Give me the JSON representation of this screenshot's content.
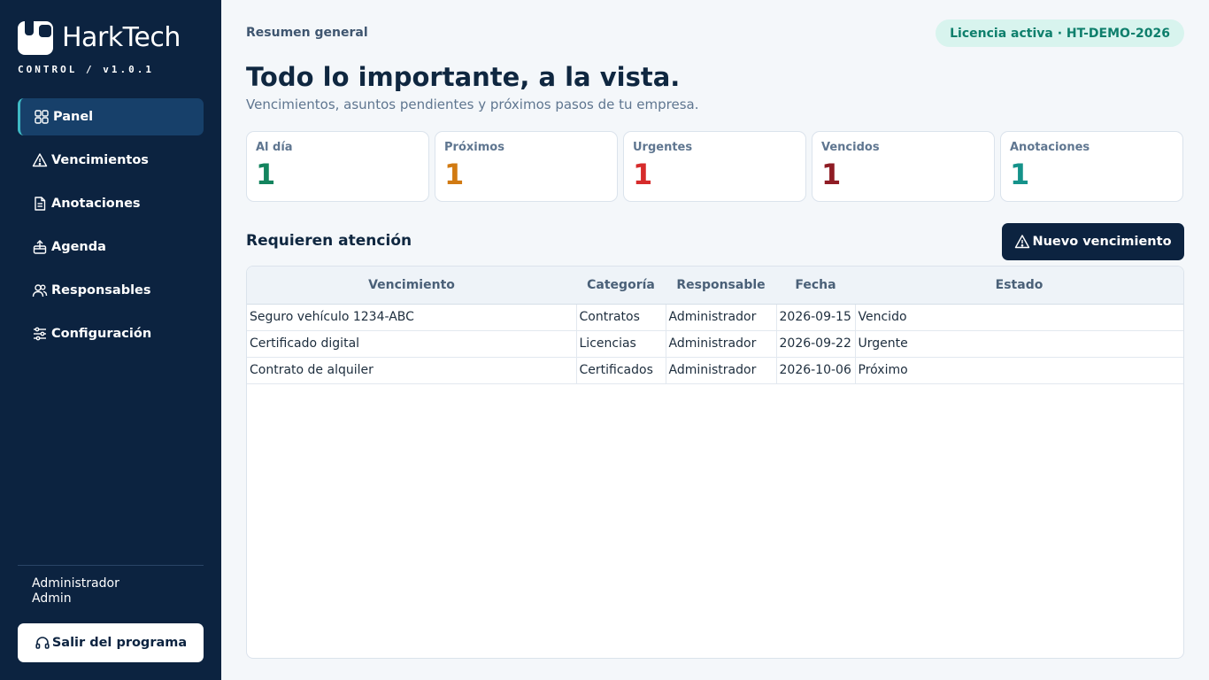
{
  "brand": {
    "name": "HarkTech",
    "subtitle": "CONTROL / v1.0.1"
  },
  "nav": [
    {
      "label": "Panel",
      "icon": "grid-icon",
      "active": true
    },
    {
      "label": "Vencimientos",
      "icon": "warning-icon"
    },
    {
      "label": "Anotaciones",
      "icon": "document-icon"
    },
    {
      "label": "Agenda",
      "icon": "upload-icon"
    },
    {
      "label": "Responsables",
      "icon": "users-icon"
    },
    {
      "label": "Configuración",
      "icon": "sliders-icon"
    }
  ],
  "user": {
    "name": "Administrador",
    "role": "Admin"
  },
  "exit_label": "Salir del programa",
  "header": {
    "breadcrumb": "Resumen general",
    "license": "Licencia activa · HT-DEMO-2026",
    "title": "Todo lo importante, a la vista.",
    "subtitle": "Vencimientos, asuntos pendientes y próximos pasos de tu empresa."
  },
  "stats": [
    {
      "label": "Al día",
      "value": "1",
      "color": "#13845e"
    },
    {
      "label": "Próximos",
      "value": "1",
      "color": "#d17a12"
    },
    {
      "label": "Urgentes",
      "value": "1",
      "color": "#d62b2b"
    },
    {
      "label": "Vencidos",
      "value": "1",
      "color": "#8f1c24"
    },
    {
      "label": "Anotaciones",
      "value": "1",
      "color": "#15928a"
    }
  ],
  "section": {
    "title": "Requieren atención",
    "new_button": "Nuevo vencimiento"
  },
  "table": {
    "columns": [
      "Vencimiento",
      "Categoría",
      "Responsable",
      "Fecha",
      "Estado"
    ],
    "rows": [
      [
        "Seguro vehículo 1234-ABC",
        "Contratos",
        "Administrador",
        "2026-09-15",
        "Vencido"
      ],
      [
        "Certificado digital",
        "Licencias",
        "Administrador",
        "2026-09-22",
        "Urgente"
      ],
      [
        "Contrato de alquiler",
        "Certificados",
        "Administrador",
        "2026-10-06",
        "Próximo"
      ]
    ]
  }
}
